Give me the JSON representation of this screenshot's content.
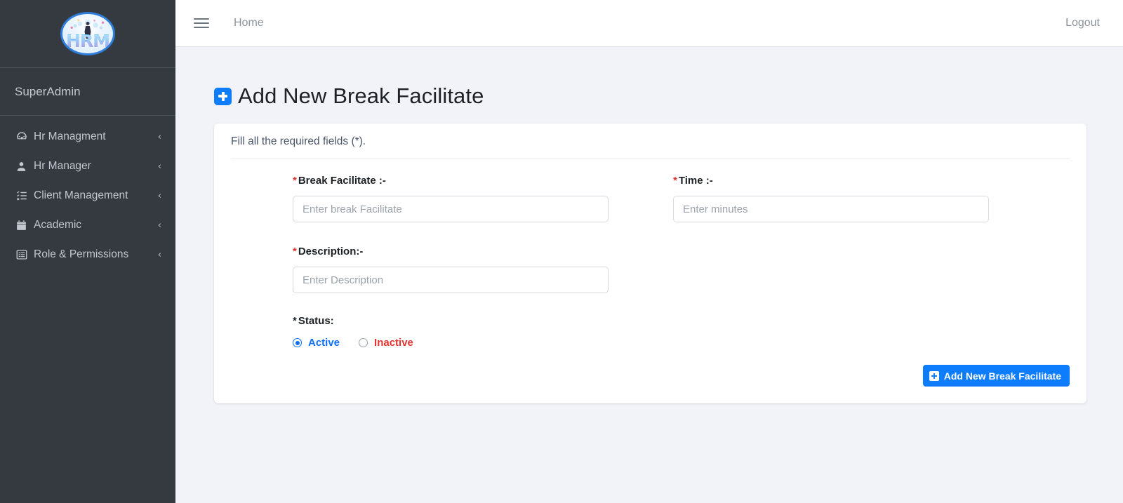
{
  "sidebar": {
    "logo_text": "HRM",
    "user_name": "SuperAdmin",
    "items": [
      {
        "label": "Hr Managment",
        "icon": "tachometer-icon",
        "chevron": "‹"
      },
      {
        "label": "Hr Manager",
        "icon": "user-icon",
        "chevron": "‹"
      },
      {
        "label": "Client Management",
        "icon": "tasks-list-icon",
        "chevron": "‹"
      },
      {
        "label": "Academic",
        "icon": "calendar-icon",
        "chevron": "‹"
      },
      {
        "label": "Role & Permissions",
        "icon": "list-alt-icon",
        "chevron": "‹"
      }
    ]
  },
  "topbar": {
    "menu_toggle_icon": "hamburger-icon",
    "home_label": "Home",
    "logout_label": "Logout"
  },
  "page": {
    "title": "Add New Break Facilitate",
    "title_icon": "plus-square-icon"
  },
  "card": {
    "instructions": "Fill all the required fields (*).",
    "fields": {
      "break_facilitate": {
        "required_mark": "*",
        "label": "Break Facilitate :-",
        "value": "",
        "placeholder": "Enter break Facilitate"
      },
      "time": {
        "required_mark": "*",
        "label": "Time :-",
        "value": "",
        "placeholder": "Enter minutes"
      },
      "description": {
        "required_mark": "*",
        "label": "Description:-",
        "value": "",
        "placeholder": "Enter Description"
      },
      "status": {
        "required_mark": "*",
        "label": "Status:",
        "selected": "Active",
        "options": [
          {
            "label": "Active",
            "value": "active",
            "checked": true
          },
          {
            "label": "Inactive",
            "value": "inactive",
            "checked": false
          }
        ]
      }
    },
    "submit_label": "Add New Break Facilitate",
    "submit_icon": "plus-square-icon"
  },
  "colors": {
    "sidebar_bg": "#343a40",
    "content_bg": "#f2f3f8",
    "primary": "#0d7dfd",
    "danger": "#e3342f",
    "active_blue": "#0d6efd"
  }
}
